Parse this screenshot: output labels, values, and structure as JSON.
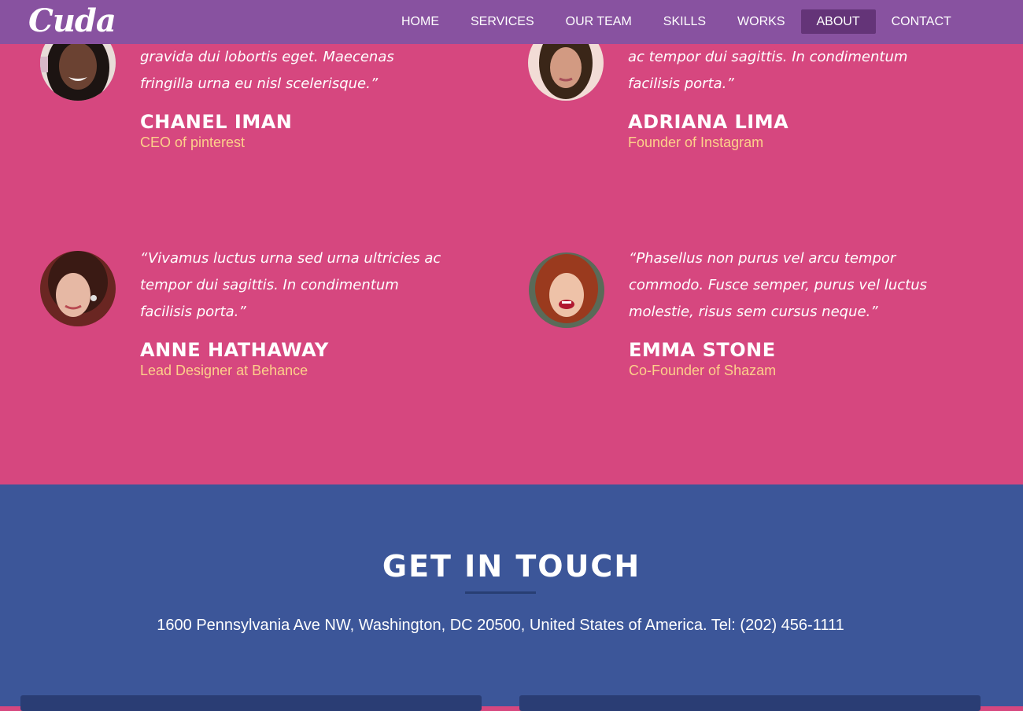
{
  "brand": {
    "logo": "Cuda"
  },
  "nav": {
    "items": [
      {
        "label": "HOME",
        "active": false
      },
      {
        "label": "SERVICES",
        "active": false
      },
      {
        "label": "OUR TEAM",
        "active": false
      },
      {
        "label": "SKILLS",
        "active": false
      },
      {
        "label": "WORKS",
        "active": false
      },
      {
        "label": "ABOUT",
        "active": true
      },
      {
        "label": "CONTACT",
        "active": false
      }
    ]
  },
  "testimonials": [
    {
      "quote": "gravida dui lobortis eget. Maecenas fringilla urna eu nisl scelerisque.”",
      "name": "CHANEL IMAN",
      "role": "CEO of pinterest"
    },
    {
      "quote": "ac tempor dui sagittis. In condimentum facilisis porta.”",
      "name": "ADRIANA LIMA",
      "role": "Founder of Instagram"
    },
    {
      "quote": "“Vivamus luctus urna sed urna ultricies ac tempor dui sagittis. In condimentum facilisis porta.”",
      "name": "ANNE HATHAWAY",
      "role": "Lead Designer at Behance"
    },
    {
      "quote": "“Phasellus non purus vel arcu tempor commodo. Fusce semper, purus vel luctus molestie, risus sem cursus neque.”",
      "name": "EMMA STONE",
      "role": "Co-Founder of Shazam"
    }
  ],
  "contact": {
    "title": "GET IN TOUCH",
    "address": "1600 Pennsylvania Ave NW, Washington, DC 20500, United States of America. Tel: (202) 456-1111"
  },
  "colors": {
    "nav_bg": "#8852a0",
    "nav_active": "#643478",
    "testimonials_bg": "#d6477f",
    "role_text": "#fdd08a",
    "contact_bg": "#3c5699"
  }
}
